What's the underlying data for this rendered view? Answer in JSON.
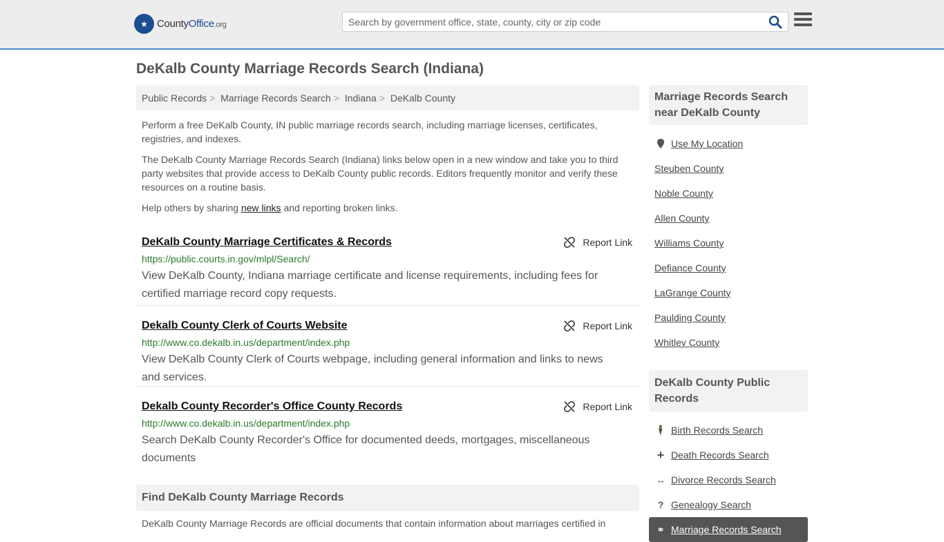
{
  "header": {
    "logo_county": "County",
    "logo_office": "Office",
    "logo_org": ".org",
    "search_placeholder": "Search by government office, state, county, city or zip code"
  },
  "page_title": "DeKalb County Marriage Records Search (Indiana)",
  "breadcrumb": [
    "Public Records",
    "Marriage Records Search",
    "Indiana",
    "DeKalb County"
  ],
  "intro": {
    "p1": "Perform a free DeKalb County, IN public marriage records search, including marriage licenses, certificates, registries, and indexes.",
    "p2": "The DeKalb County Marriage Records Search (Indiana) links below open in a new window and take you to third party websites that provide access to DeKalb County public records. Editors frequently monitor and verify these resources on a routine basis.",
    "p3_before": "Help others by sharing ",
    "p3_link": "new links",
    "p3_after": " and reporting broken links."
  },
  "report_label": "Report Link",
  "results": [
    {
      "title": "DeKalb County Marriage Certificates & Records",
      "url": "https://public.courts.in.gov/mlpl/Search/",
      "desc": "View DeKalb County, Indiana marriage certificate and license requirements, including fees for certified marriage record copy requests."
    },
    {
      "title": "Dekalb County Clerk of Courts Website",
      "url": "http://www.co.dekalb.in.us/department/index.php",
      "desc": "View DeKalb County Clerk of Courts webpage, including general information and links to news and services."
    },
    {
      "title": "Dekalb County Recorder's Office County Records",
      "url": "http://www.co.dekalb.in.us/department/index.php",
      "desc": "Search DeKalb County Recorder's Office for documented deeds, mortgages, miscellaneous documents"
    }
  ],
  "find_heading": "Find DeKalb County Marriage Records",
  "find_desc": "DeKalb County Marriage Records are official documents that contain information about marriages certified in",
  "sidebar": {
    "nearby_heading": "Marriage Records Search near DeKalb County",
    "use_location": "Use My Location",
    "nearby": [
      "Steuben County",
      "Noble County",
      "Allen County",
      "Williams County",
      "Defiance County",
      "LaGrange County",
      "Paulding County",
      "Whitley County"
    ],
    "public_heading": "DeKalb County Public Records",
    "public_links": [
      {
        "label": "Birth Records Search",
        "icon": "person-icon"
      },
      {
        "label": "Death Records Search",
        "icon": "cross-icon"
      },
      {
        "label": "Divorce Records Search",
        "icon": "arrows-icon"
      },
      {
        "label": "Genealogy Search",
        "icon": "question-icon"
      },
      {
        "label": "Marriage Records Search",
        "icon": "rings-icon"
      }
    ]
  },
  "colors": {
    "accent": "#4a8ac9",
    "url_green": "#2b7a2b",
    "logo_blue": "#1d4c8f"
  }
}
